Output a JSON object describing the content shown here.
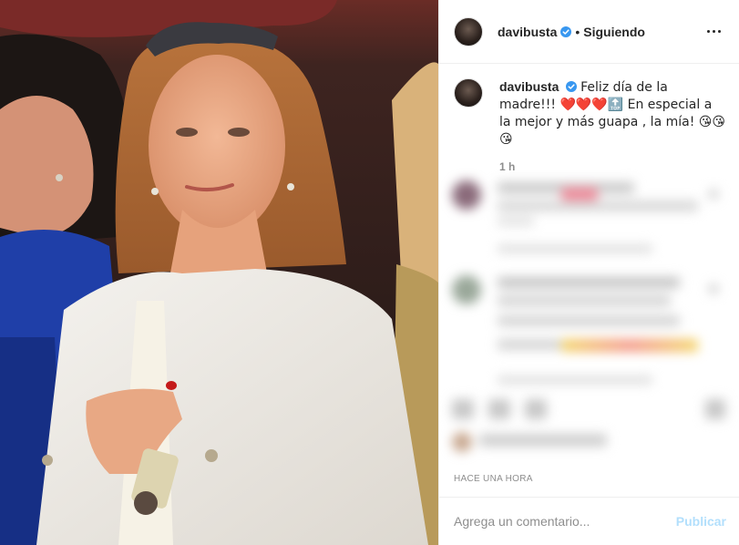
{
  "post": {
    "author": "davibusta",
    "follow_status": "Siguiendo",
    "separator": "•",
    "caption": "Feliz día de la madre!!! ❤️❤️❤️🔝 En especial a la mejor y más guapa , la mía! 😘😘😘",
    "caption_age": "1 h",
    "posted": "HACE UNA HORA"
  },
  "comment_box": {
    "placeholder": "Agrega un comentario...",
    "publish_label": "Publicar"
  },
  "icons": {
    "verified": "verified-badge-icon",
    "more": "more-options-icon"
  },
  "colors": {
    "verified_blue": "#3897f0",
    "publish_disabled": "#b2dffc",
    "secondary_text": "#8e8e8e"
  }
}
